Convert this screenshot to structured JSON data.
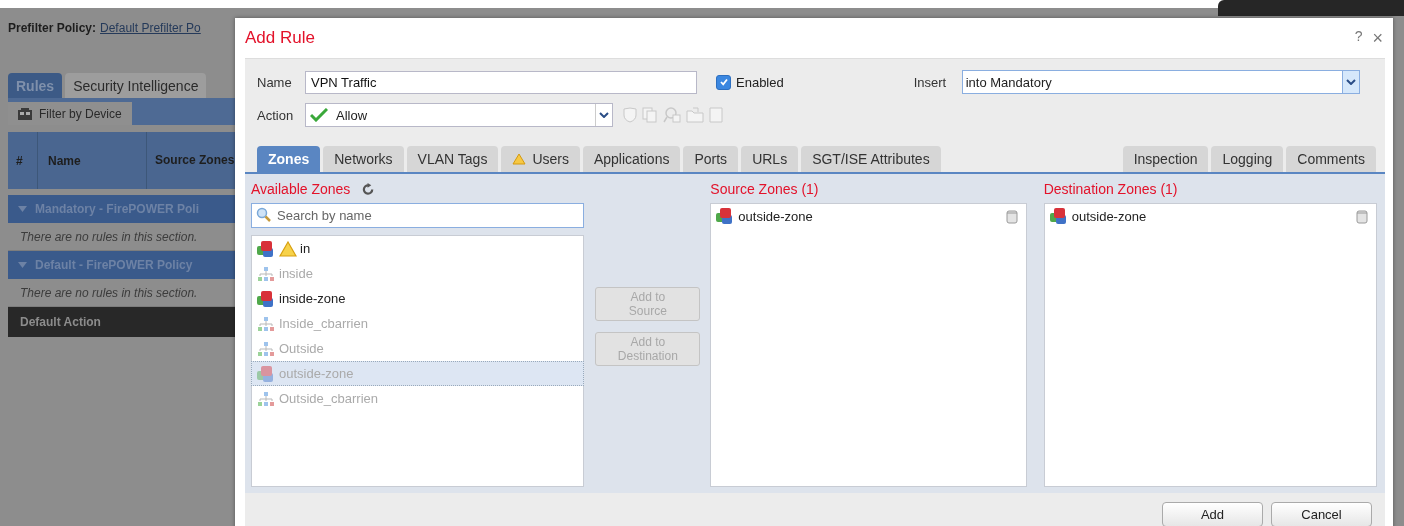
{
  "background_page": {
    "policy_label": "Prefilter Policy:",
    "policy_link": "Default Prefilter Po",
    "tabs": [
      {
        "label": "Rules",
        "selected": true
      },
      {
        "label": "Security Intelligence",
        "selected": false
      }
    ],
    "filter_button": "Filter by Device",
    "table": {
      "columns": [
        "#",
        "Name",
        "Source Zones"
      ],
      "sections": [
        {
          "title": "Mandatory - FirePOWER Poli",
          "message": "There are no rules in this section."
        },
        {
          "title": "Default - FirePOWER Policy",
          "message": "There are no rules in this section."
        }
      ],
      "default_action": "Default Action"
    }
  },
  "dialog": {
    "title": "Add Rule",
    "help": "?",
    "close": "×",
    "name_label": "Name",
    "name_value": "VPN Traffic",
    "enabled": {
      "label": "Enabled",
      "checked": true
    },
    "insert_label": "Insert",
    "insert_value": "into Mandatory",
    "action_label": "Action",
    "action_value": "Allow",
    "tabs": [
      {
        "label": "Zones",
        "selected": true,
        "warning": false
      },
      {
        "label": "Networks",
        "selected": false,
        "warning": false
      },
      {
        "label": "VLAN Tags",
        "selected": false,
        "warning": false
      },
      {
        "label": "Users",
        "selected": false,
        "warning": true
      },
      {
        "label": "Applications",
        "selected": false,
        "warning": false
      },
      {
        "label": "Ports",
        "selected": false,
        "warning": false
      },
      {
        "label": "URLs",
        "selected": false,
        "warning": false
      },
      {
        "label": "SGT/ISE Attributes",
        "selected": false,
        "warning": false
      }
    ],
    "right_tabs": [
      {
        "label": "Inspection",
        "selected": false
      },
      {
        "label": "Logging",
        "selected": false
      },
      {
        "label": "Comments",
        "selected": false
      }
    ],
    "available": {
      "title": "Available Zones",
      "placeholder": "Search by name",
      "items": [
        {
          "name": "in",
          "kind": "zone",
          "warning": true,
          "disabled": false,
          "selected": false
        },
        {
          "name": "inside",
          "kind": "interface",
          "warning": false,
          "disabled": true,
          "selected": false
        },
        {
          "name": "inside-zone",
          "kind": "zone",
          "warning": false,
          "disabled": false,
          "selected": false
        },
        {
          "name": "Inside_cbarrien",
          "kind": "interface",
          "warning": false,
          "disabled": true,
          "selected": false
        },
        {
          "name": "Outside",
          "kind": "interface",
          "warning": false,
          "disabled": true,
          "selected": false
        },
        {
          "name": "outside-zone",
          "kind": "zone",
          "warning": false,
          "disabled": true,
          "selected": true
        },
        {
          "name": "Outside_cbarrien",
          "kind": "interface",
          "warning": false,
          "disabled": true,
          "selected": false
        }
      ]
    },
    "add_to_source": {
      "label": "Add to Source",
      "disabled": true
    },
    "add_to_destination": {
      "label": "Add to Destination",
      "disabled": true
    },
    "source": {
      "title": "Source Zones (1)",
      "items": [
        {
          "name": "outside-zone"
        }
      ]
    },
    "destination": {
      "title": "Destination Zones (1)",
      "items": [
        {
          "name": "outside-zone"
        }
      ]
    },
    "buttons": [
      "Add",
      "Cancel"
    ]
  }
}
